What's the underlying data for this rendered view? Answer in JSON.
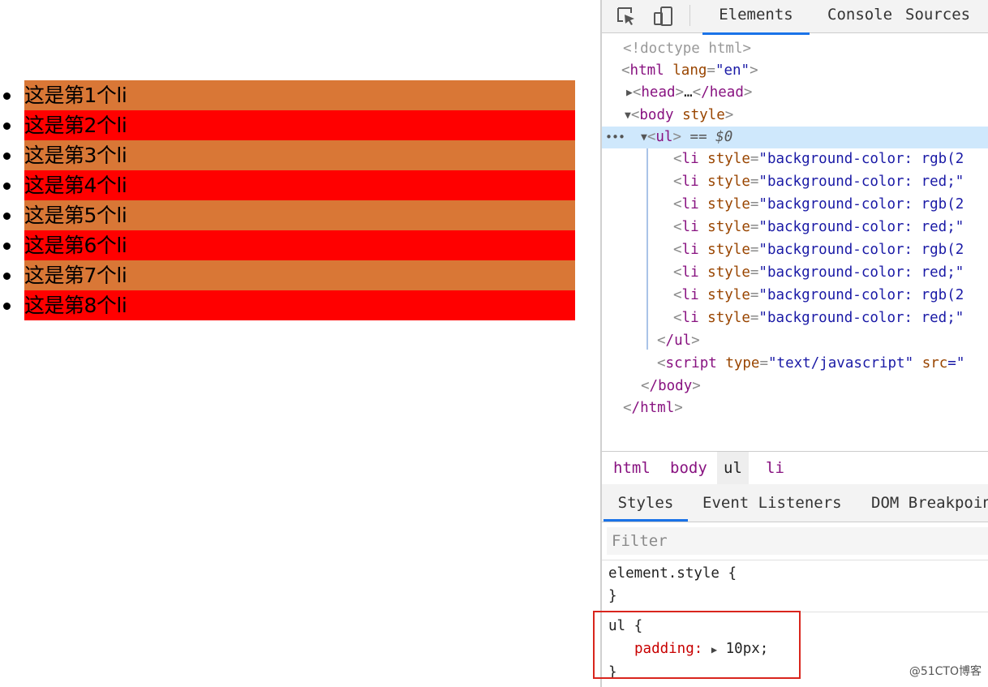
{
  "page": {
    "list_items": [
      {
        "label": "这是第1个li",
        "color": "#d97736"
      },
      {
        "label": "这是第2个li",
        "color": "#ff0000"
      },
      {
        "label": "这是第3个li",
        "color": "#d97736"
      },
      {
        "label": "这是第4个li",
        "color": "#ff0000"
      },
      {
        "label": "这是第5个li",
        "color": "#d97736"
      },
      {
        "label": "这是第6个li",
        "color": "#ff0000"
      },
      {
        "label": "这是第7个li",
        "color": "#d97736"
      },
      {
        "label": "这是第8个li",
        "color": "#ff0000"
      }
    ]
  },
  "devtools": {
    "toolbar_icons": [
      "inspect-element-icon",
      "device-toolbar-icon"
    ],
    "tabs": [
      "Elements",
      "Console",
      "Sources"
    ],
    "active_tab": "Elements",
    "dom": {
      "doctype": "<!doctype html>",
      "html_open": {
        "tag": "html",
        "attr": "lang",
        "value": "\"en\""
      },
      "head": {
        "open": "head",
        "ellipsis": "…",
        "close": "/head"
      },
      "body_open": {
        "tag": "body",
        "attr": "style"
      },
      "ul_open": {
        "tag": "ul",
        "marker": "== $0",
        "dots": "•••"
      },
      "li_rows": [
        {
          "tag": "li",
          "attr": "style",
          "value": "\"background-color: rgb(2"
        },
        {
          "tag": "li",
          "attr": "style",
          "value": "\"background-color: red;\""
        },
        {
          "tag": "li",
          "attr": "style",
          "value": "\"background-color: rgb(2"
        },
        {
          "tag": "li",
          "attr": "style",
          "value": "\"background-color: red;\""
        },
        {
          "tag": "li",
          "attr": "style",
          "value": "\"background-color: rgb(2"
        },
        {
          "tag": "li",
          "attr": "style",
          "value": "\"background-color: red;\""
        },
        {
          "tag": "li",
          "attr": "style",
          "value": "\"background-color: rgb(2"
        },
        {
          "tag": "li",
          "attr": "style",
          "value": "\"background-color: red;\""
        }
      ],
      "ul_close": "/ul",
      "script": {
        "tag": "script",
        "attr1": "type",
        "value1": "\"text/javascript\"",
        "attr2": "src",
        "value2": "=\""
      },
      "body_close": "/body",
      "html_close": "/html"
    },
    "breadcrumbs": [
      "html",
      "body",
      "ul",
      "li"
    ],
    "active_breadcrumb": "ul",
    "style_tabs": [
      "Styles",
      "Event Listeners",
      "DOM Breakpoin"
    ],
    "active_style_tab": "Styles",
    "filter_placeholder": "Filter",
    "rules": {
      "element_style": {
        "selector": "element.style {",
        "close": "}"
      },
      "ul_rule": {
        "selector": "ul {",
        "property": "padding",
        "colon": ":",
        "value": "10px;",
        "close": "}"
      }
    }
  },
  "watermark": "@51CTO博客"
}
